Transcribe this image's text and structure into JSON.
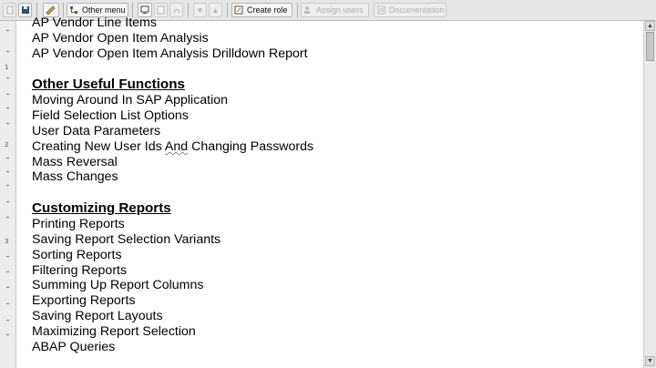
{
  "toolbar": {
    "other_menu": "Other menu",
    "create_role": "Create role",
    "assign_users": "Assign users",
    "documentation": "Documentation"
  },
  "ruler": {
    "marks": [
      "1",
      "2",
      "3"
    ]
  },
  "document": {
    "partial_item": "AP Vendor Line Items",
    "ap_items": [
      "AP Vendor Open Item Analysis",
      "AP Vendor Open Item Analysis Drilldown Report"
    ],
    "other_functions": {
      "heading": "Other Useful Functions",
      "items": [
        "Moving Around In SAP Application",
        "Field Selection List Options",
        "User Data Parameters",
        "Creating New User Ids And Changing Passwords",
        "Mass Reversal",
        "Mass Changes"
      ]
    },
    "customizing": {
      "heading": "Customizing Reports",
      "items": [
        "Printing Reports",
        "Saving Report Selection Variants",
        "Sorting Reports",
        "Filtering Reports",
        "Summing Up Report Columns",
        "Exporting Reports",
        "Saving Report Layouts",
        "Maximizing Report Selection",
        "ABAP Queries"
      ]
    }
  }
}
